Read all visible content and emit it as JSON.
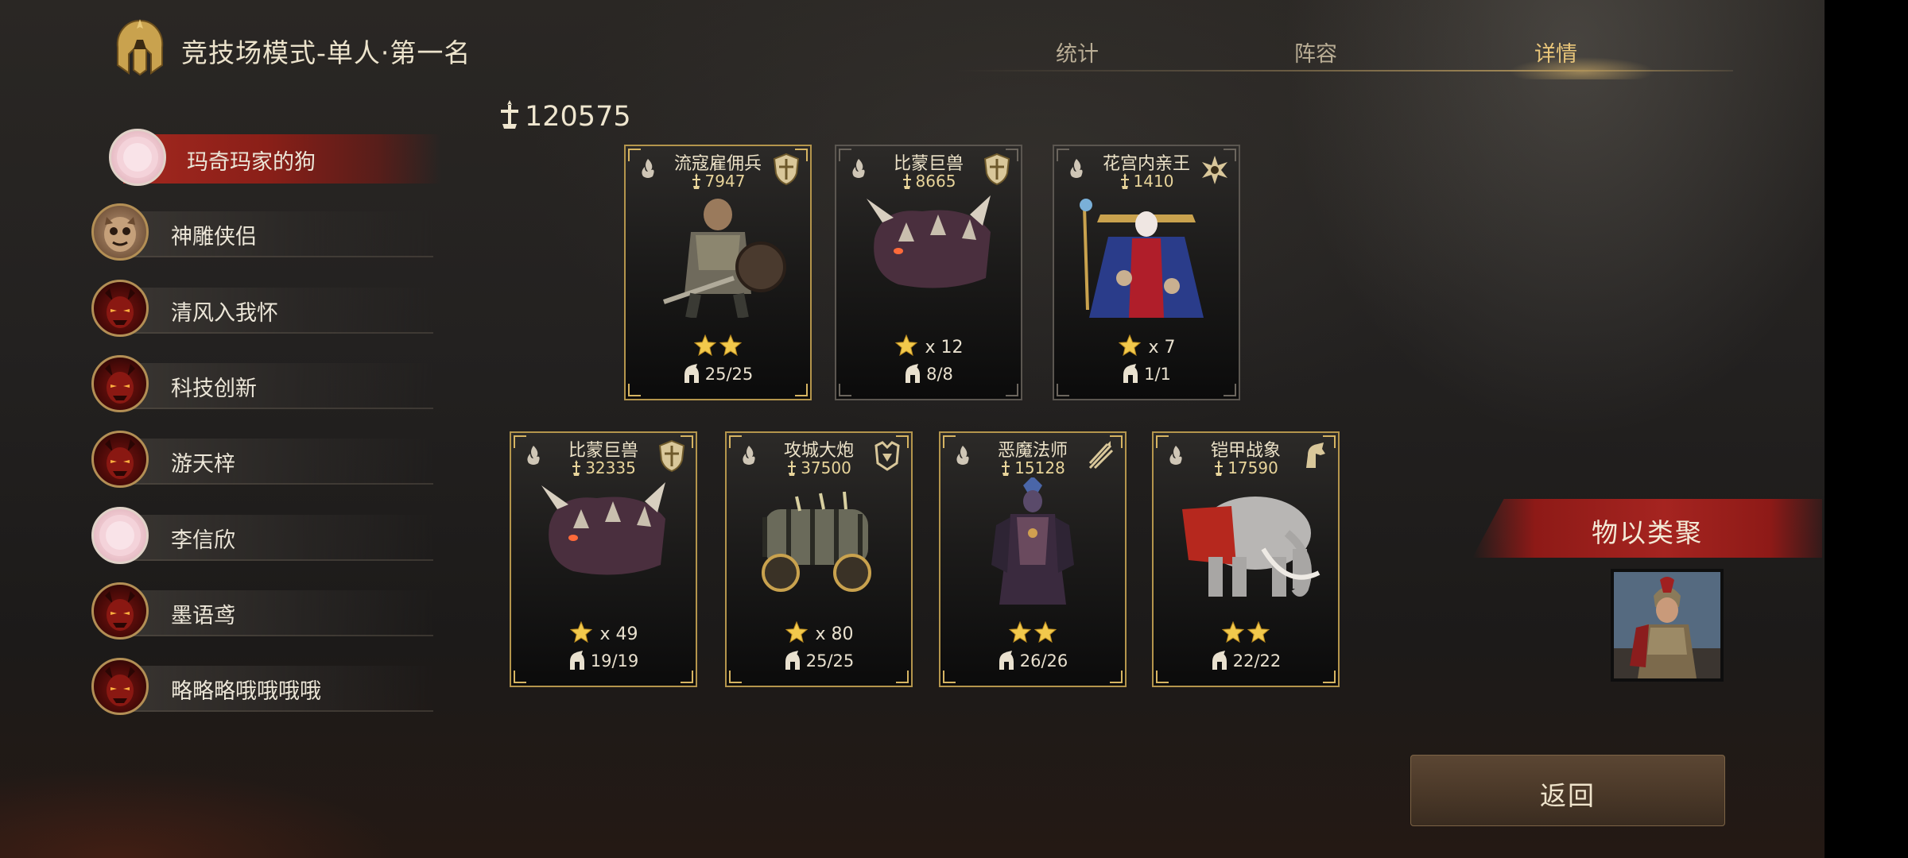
{
  "header": {
    "title": "竞技场模式-单人·第一名",
    "tabs": [
      {
        "label": "统计",
        "active": false
      },
      {
        "label": "阵容",
        "active": false
      },
      {
        "label": "详情",
        "active": true
      }
    ]
  },
  "players": [
    {
      "name": "玛奇玛家的狗",
      "avatar": "pink",
      "active": true
    },
    {
      "name": "神雕侠侣",
      "avatar": "fox",
      "active": false
    },
    {
      "name": "清风入我怀",
      "avatar": "demon",
      "active": false
    },
    {
      "name": "科技创新",
      "avatar": "demon",
      "active": false
    },
    {
      "name": "游天梓",
      "avatar": "demon",
      "active": false
    },
    {
      "name": "李信欣",
      "avatar": "pink",
      "active": false
    },
    {
      "name": "墨语鸢",
      "avatar": "demon",
      "active": false
    },
    {
      "name": "略略略哦哦哦哦",
      "avatar": "demon",
      "active": false
    }
  ],
  "total_power": "120575",
  "units": [
    {
      "name": "流寇雇佣兵",
      "power": "7947",
      "stars": 2,
      "star_count": "",
      "troops": "25/25",
      "class_icon": "shield-icon",
      "art": "knight",
      "frame": "gold"
    },
    {
      "name": "比蒙巨兽",
      "power": "8665",
      "stars": 1,
      "star_count": "x 12",
      "troops": "8/8",
      "class_icon": "shield-icon",
      "art": "beast",
      "frame": "gray"
    },
    {
      "name": "花宫内亲王",
      "power": "1410",
      "stars": 1,
      "star_count": "x 7",
      "troops": "1/1",
      "class_icon": "lotus-icon",
      "art": "princess",
      "frame": "gray"
    },
    {
      "name": "比蒙巨兽",
      "power": "32335",
      "stars": 1,
      "star_count": "x 49",
      "troops": "19/19",
      "class_icon": "shield-icon",
      "art": "beast",
      "frame": "gold"
    },
    {
      "name": "攻城大炮",
      "power": "37500",
      "stars": 1,
      "star_count": "x 80",
      "troops": "25/25",
      "class_icon": "siege-icon",
      "art": "cannon",
      "frame": "gold"
    },
    {
      "name": "恶魔法师",
      "power": "15128",
      "stars": 2,
      "star_count": "",
      "troops": "26/26",
      "class_icon": "arrows-icon",
      "art": "mage",
      "frame": "gold"
    },
    {
      "name": "铠甲战象",
      "power": "17590",
      "stars": 2,
      "star_count": "",
      "troops": "22/22",
      "class_icon": "horse-icon",
      "art": "elephant",
      "frame": "gold"
    }
  ],
  "synergy_label": "物以类聚",
  "back_label": "返回",
  "colors": {
    "accent_gold": "#e9c67a",
    "active_red": "#a3281f",
    "frame_gold": "#b4954c"
  }
}
